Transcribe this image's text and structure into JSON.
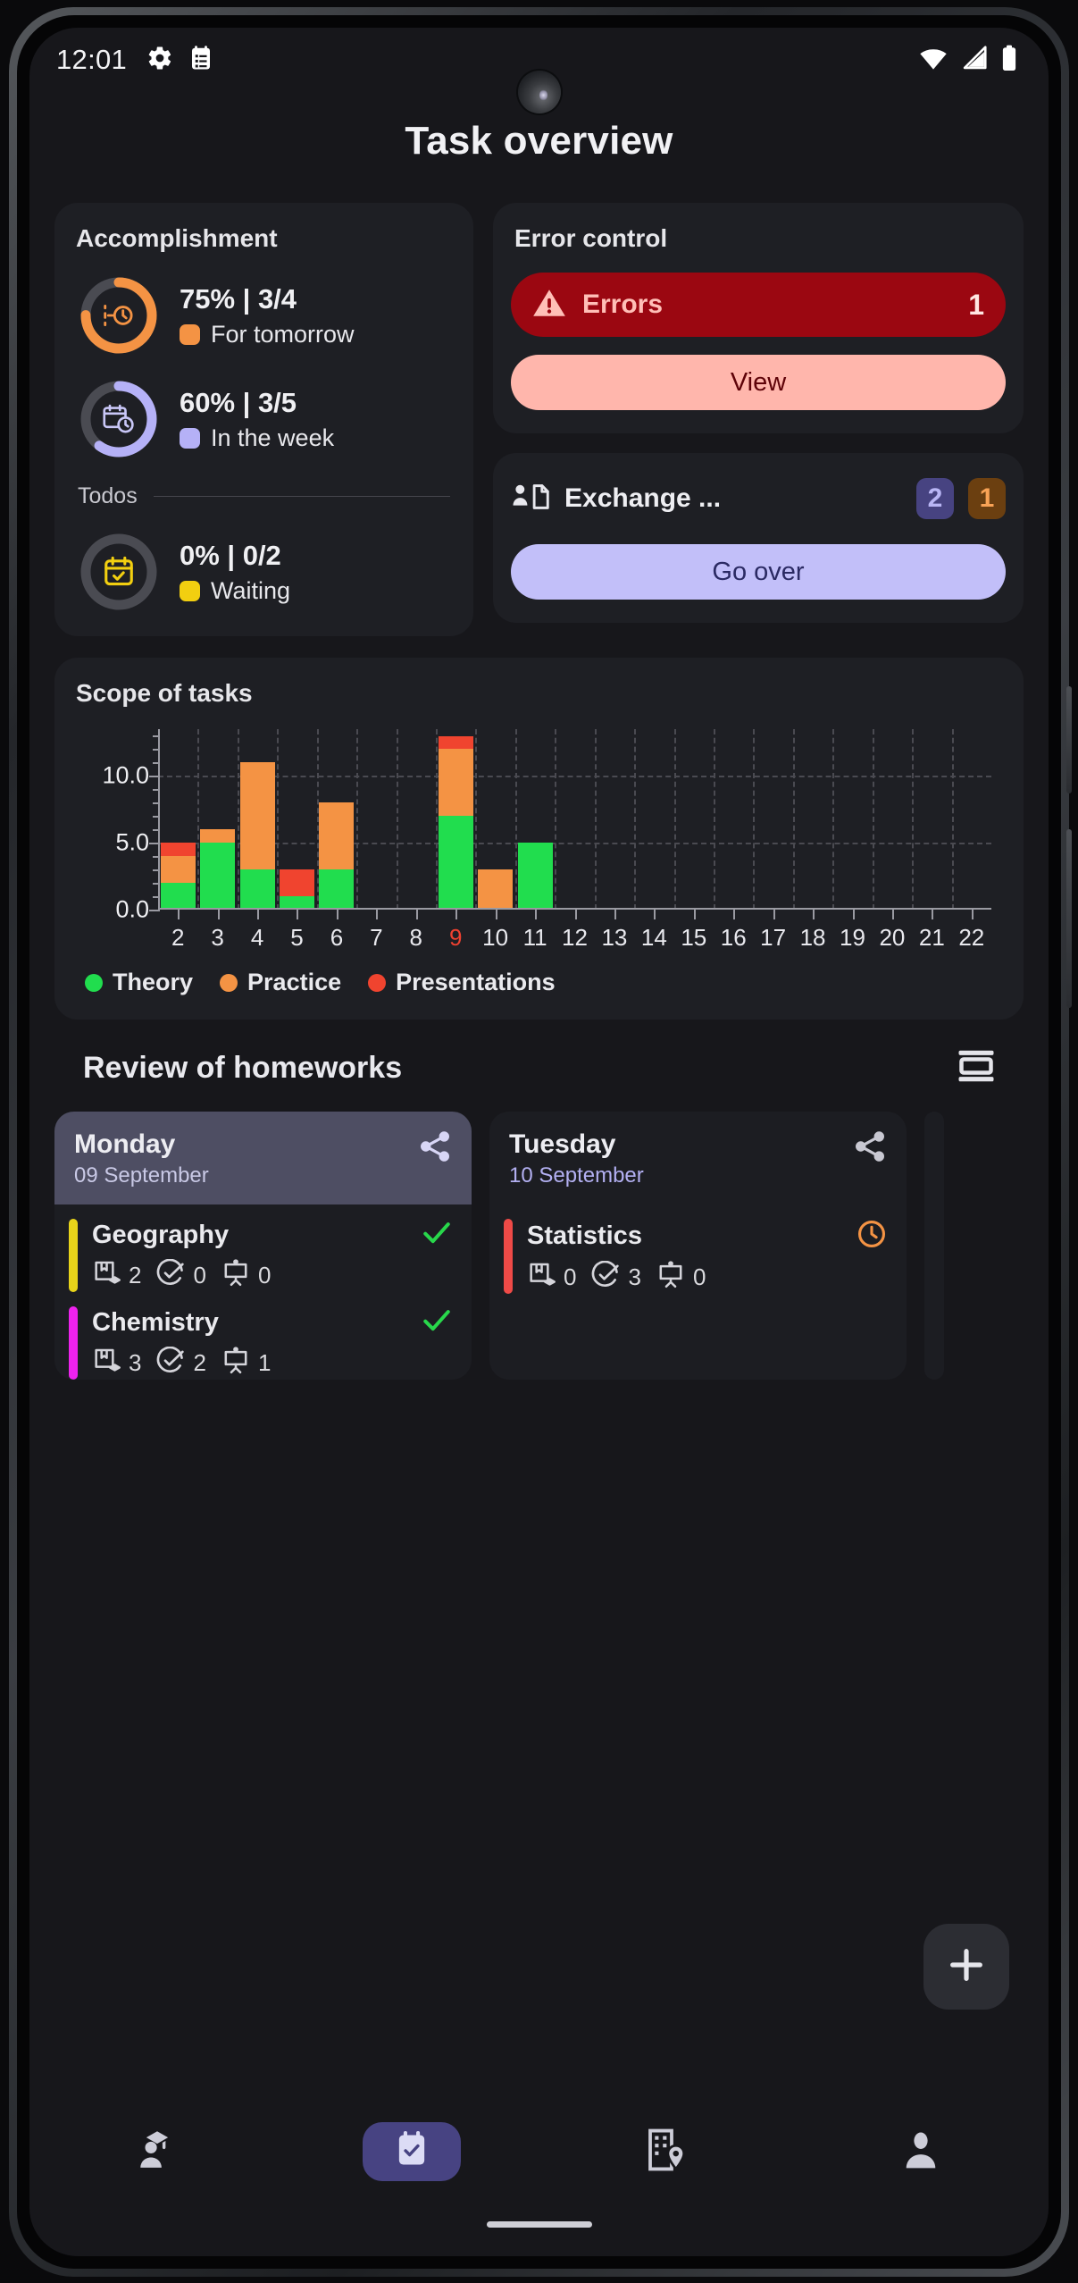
{
  "statusbar": {
    "time": "12:01",
    "icons_left": [
      "gear-icon",
      "clipboard-list-icon"
    ],
    "icons_right": [
      "wifi-icon",
      "cellular-signal-icon",
      "battery-icon"
    ]
  },
  "page": {
    "title": "Task overview"
  },
  "accomplishment": {
    "title": "Accomplishment",
    "todos_label": "Todos",
    "stats": [
      {
        "value": "75% | 3/4",
        "legend": "For tomorrow",
        "color": "#f49344",
        "percent": 75,
        "icon": "timer-clock-icon"
      },
      {
        "value": "60% | 3/5",
        "legend": "In the week",
        "color": "#b5b1f7",
        "percent": 60,
        "icon": "calendar-clock-icon"
      },
      {
        "value": "0% | 0/2",
        "legend": "Waiting",
        "color": "#f2cf10",
        "percent": 0,
        "icon": "calendar-check-icon"
      }
    ]
  },
  "error_control": {
    "title": "Error control",
    "errors_label": "Errors",
    "errors_count": "1",
    "view_label": "View",
    "colors": {
      "banner": "#9b0711",
      "button": "#ffb6ac"
    }
  },
  "exchange": {
    "label": "Exchange ...",
    "badges": [
      {
        "value": "2",
        "color": "#474381"
      },
      {
        "value": "1",
        "color": "#6b3f10"
      }
    ],
    "button_label": "Go over"
  },
  "scope": {
    "title": "Scope of tasks"
  },
  "chart_data": {
    "type": "bar",
    "stacked": true,
    "title": "Scope of tasks",
    "xlabel": "",
    "ylabel": "",
    "ylim": [
      0,
      13.5
    ],
    "yticks": [
      0.0,
      5.0,
      10.0
    ],
    "ytick_labels": [
      "0.0",
      "5.0",
      "10.0"
    ],
    "grid": true,
    "legend_position": "bottom-left",
    "highlight_category": "9",
    "categories": [
      "2",
      "3",
      "4",
      "5",
      "6",
      "7",
      "8",
      "9",
      "10",
      "11",
      "12",
      "13",
      "14",
      "15",
      "16",
      "17",
      "18",
      "19",
      "20",
      "21",
      "22"
    ],
    "series": [
      {
        "name": "Theory",
        "color": "#21dd4e",
        "values": [
          2,
          5,
          3,
          1,
          3,
          0,
          0,
          7,
          0,
          5,
          0,
          0,
          0,
          0,
          0,
          0,
          0,
          0,
          0,
          0,
          0
        ]
      },
      {
        "name": "Practice",
        "color": "#f49344",
        "values": [
          2,
          1,
          8,
          0,
          5,
          0,
          0,
          5,
          3,
          0,
          0,
          0,
          0,
          0,
          0,
          0,
          0,
          0,
          0,
          0,
          0
        ]
      },
      {
        "name": "Presentations",
        "color": "#f0442f",
        "values": [
          1,
          0,
          0,
          2,
          0,
          0,
          0,
          1,
          0,
          0,
          0,
          0,
          0,
          0,
          0,
          0,
          0,
          0,
          0,
          0,
          0
        ]
      }
    ],
    "totals": [
      5,
      6,
      11,
      3,
      8,
      0,
      0,
      13,
      3,
      5,
      0,
      0,
      0,
      0,
      0,
      0,
      0,
      0,
      0,
      0,
      0
    ]
  },
  "review": {
    "title": "Review of homeworks",
    "layout_icon": "layout-toggle-icon",
    "days": [
      {
        "name": "Monday",
        "date": "09 September",
        "highlighted": true,
        "share_icon": "share-icon",
        "subjects": [
          {
            "name": "Geography",
            "bar_color": "#e8d41a",
            "status_icon": "check-icon",
            "status_color": "#28d74b",
            "metrics": [
              {
                "icon": "book-layers-icon",
                "value": "2"
              },
              {
                "icon": "check-circle-icon",
                "value": "0"
              },
              {
                "icon": "presentation-board-icon",
                "value": "0"
              }
            ]
          },
          {
            "name": "Chemistry",
            "bar_color": "#ee22ee",
            "status_icon": "check-icon",
            "status_color": "#28d74b",
            "metrics": [
              {
                "icon": "book-layers-icon",
                "value": "3"
              },
              {
                "icon": "check-circle-icon",
                "value": "2"
              },
              {
                "icon": "presentation-board-icon",
                "value": "1"
              }
            ]
          }
        ]
      },
      {
        "name": "Tuesday",
        "date": "10 September",
        "highlighted": false,
        "share_icon": "share-icon",
        "subjects": [
          {
            "name": "Statistics",
            "bar_color": "#ef4a47",
            "status_icon": "clock-icon",
            "status_color": "#f49344",
            "metrics": [
              {
                "icon": "book-layers-icon",
                "value": "0"
              },
              {
                "icon": "check-circle-icon",
                "value": "3"
              },
              {
                "icon": "presentation-board-icon",
                "value": "0"
              }
            ]
          }
        ]
      }
    ]
  },
  "fab": {
    "icon": "plus-icon"
  },
  "bottom_nav": {
    "items": [
      {
        "icon": "graduate-person-icon",
        "active": false
      },
      {
        "icon": "calendar-check-icon",
        "active": true
      },
      {
        "icon": "building-location-icon",
        "active": false
      },
      {
        "icon": "person-icon",
        "active": false
      }
    ]
  }
}
